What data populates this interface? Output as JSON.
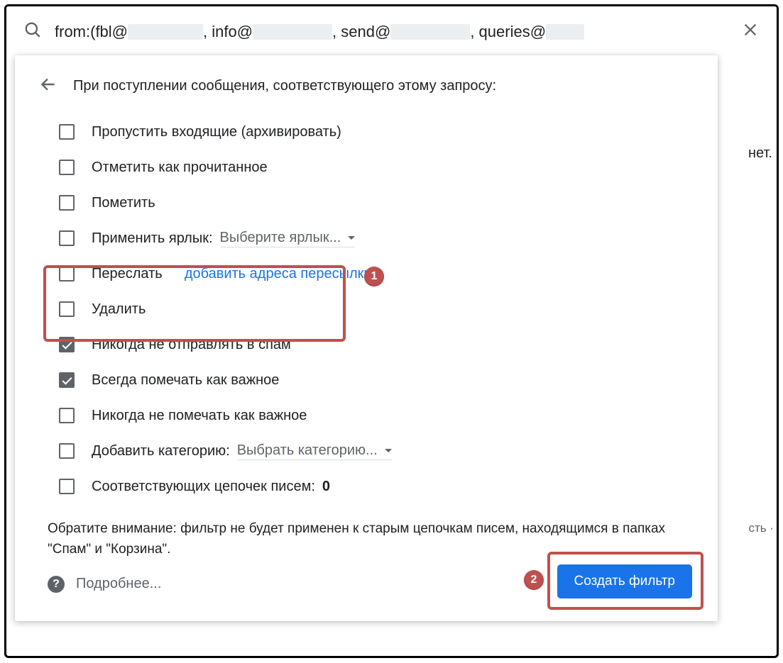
{
  "search": {
    "prefix": "from:(fbl@",
    "mid1": ", info@",
    "mid2": ", send@",
    "mid3": ", queries@"
  },
  "panel": {
    "title": "При поступлении сообщения, соответствующего этому запросу:"
  },
  "options": {
    "skip_inbox": "Пропустить входящие (архивировать)",
    "mark_read": "Отметить как прочитанное",
    "star": "Пометить",
    "apply_label_prefix": "Применить ярлык:",
    "apply_label_dd": "Выберите ярлык...",
    "forward": "Переслать",
    "forward_link": "добавить адреса пересылки",
    "delete": "Удалить",
    "never_spam": "Никогда не отправлять в спам",
    "always_important": "Всегда помечать как важное",
    "never_important": "Никогда не помечать как важное",
    "add_category_prefix": "Добавить категорию:",
    "add_category_dd": "Выбрать категорию...",
    "matching_prefix": "Соответствующих цепочек писем: ",
    "matching_count": "0"
  },
  "note": "Обратите внимание: фильтр не будет применен к старым цепочкам писем, находящимся в папках \"Спам\" и \"Корзина\".",
  "footer": {
    "learn_more": "Подробнее...",
    "create": "Создать фильтр"
  },
  "badges": {
    "1": "1",
    "2": "2"
  },
  "bg": {
    "right1": "нет.",
    "right2": "сть ·"
  }
}
